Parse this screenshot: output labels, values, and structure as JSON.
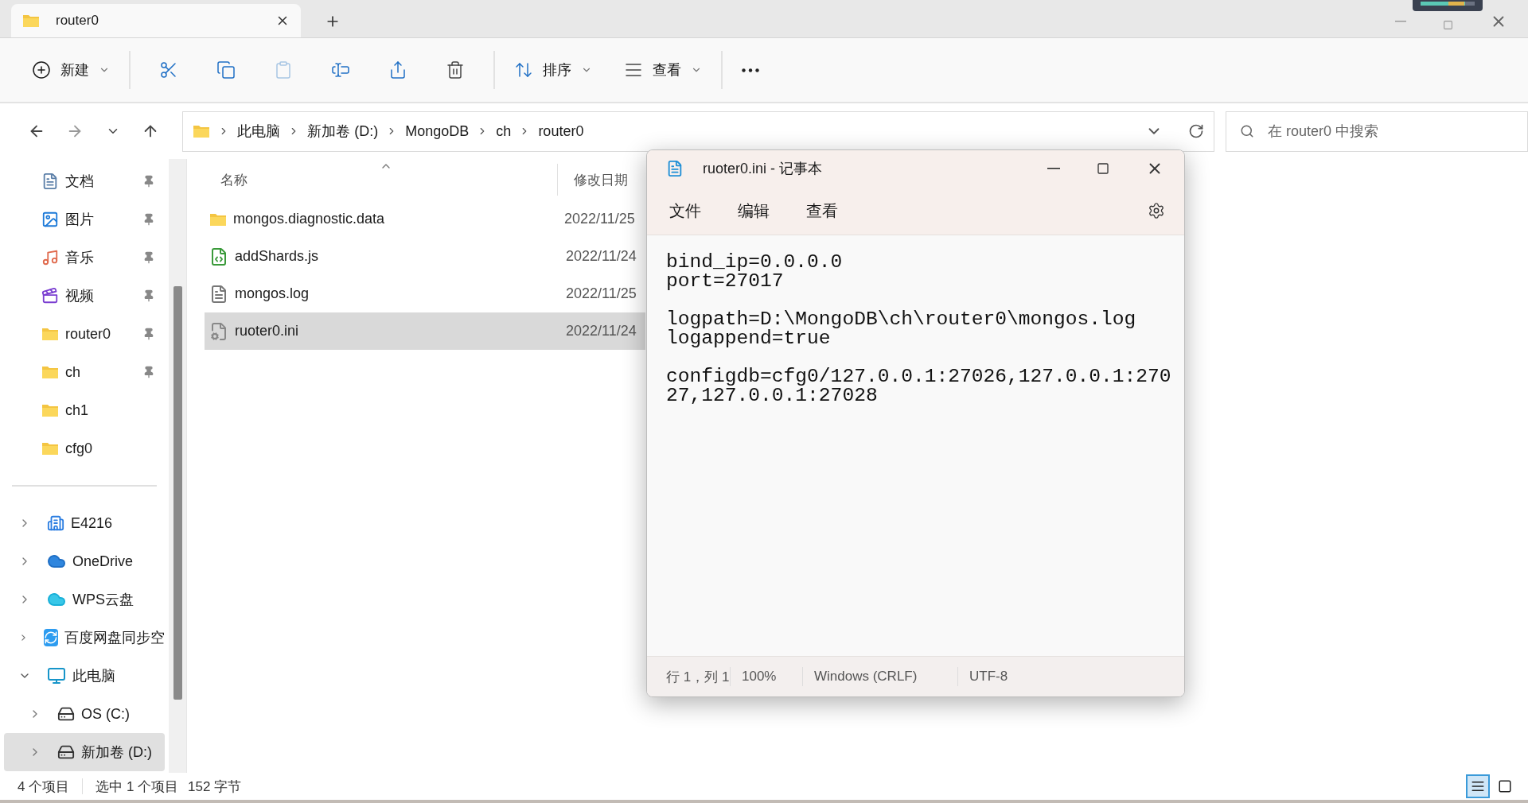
{
  "explorer": {
    "tab": {
      "title": "router0"
    },
    "toolbar": {
      "new": "新建",
      "sort": "排序",
      "view": "查看"
    },
    "breadcrumb": [
      "此电脑",
      "新加卷 (D:)",
      "MongoDB",
      "ch",
      "router0"
    ],
    "search": {
      "placeholder": "在 router0 中搜索"
    },
    "sidebar": {
      "quick_access": [
        {
          "label": "文档",
          "kind": "document",
          "pinned": true
        },
        {
          "label": "图片",
          "kind": "picture",
          "pinned": true
        },
        {
          "label": "音乐",
          "kind": "music",
          "pinned": true
        },
        {
          "label": "视频",
          "kind": "video",
          "pinned": true
        },
        {
          "label": "router0",
          "kind": "folder",
          "pinned": true
        },
        {
          "label": "ch",
          "kind": "folder",
          "pinned": true
        },
        {
          "label": "ch1",
          "kind": "folder",
          "pinned": false
        },
        {
          "label": "cfg0",
          "kind": "folder",
          "pinned": false
        }
      ],
      "tree": [
        {
          "label": "E4216",
          "kind": "building",
          "expanded": false,
          "selected": false
        },
        {
          "label": "OneDrive",
          "kind": "cloud",
          "expanded": false,
          "selected": false
        },
        {
          "label": "WPS云盘",
          "kind": "cloud",
          "expanded": false,
          "selected": false
        },
        {
          "label": "百度网盘同步空",
          "kind": "sync",
          "expanded": false,
          "selected": false
        },
        {
          "label": "此电脑",
          "kind": "pc",
          "expanded": true,
          "selected": false,
          "children": [
            {
              "label": "OS (C:)",
              "kind": "drive",
              "expanded": false,
              "selected": false
            },
            {
              "label": "新加卷 (D:)",
              "kind": "drive",
              "expanded": false,
              "selected": true
            }
          ]
        }
      ]
    },
    "columns": [
      {
        "label": "名称",
        "sorted": true
      },
      {
        "label": "修改日期",
        "sorted": false
      }
    ],
    "files": [
      {
        "name": "mongos.diagnostic.data",
        "date": "2022/11/25",
        "kind": "folder",
        "selected": false
      },
      {
        "name": "addShards.js",
        "date": "2022/11/24",
        "kind": "script",
        "selected": false
      },
      {
        "name": "mongos.log",
        "date": "2022/11/25",
        "kind": "text",
        "selected": false
      },
      {
        "name": "ruoter0.ini",
        "date": "2022/11/24",
        "kind": "settings",
        "selected": true
      }
    ],
    "status_bar": {
      "count": "4 个项目",
      "selection": "选中 1 个项目",
      "size": "152 字节"
    },
    "view_toggles": [
      {
        "kind": "details",
        "selected": true
      },
      {
        "kind": "tiles",
        "selected": false
      }
    ]
  },
  "notepad": {
    "title": "ruoter0.ini - 记事本",
    "menu": [
      "文件",
      "编辑",
      "查看"
    ],
    "paragraphs": [
      [
        "bind_ip=0.0.0.0",
        "port=27017"
      ],
      [
        "logpath=D:\\MongoDB\\ch\\router0\\mongos.log",
        "logappend=true"
      ],
      [
        "configdb=cfg0/127.0.0.1:27026,127.0.0.1:270",
        "27,127.0.0.1:27028"
      ]
    ],
    "status": [
      "行 1，列 1",
      "100%",
      "Windows (CRLF)",
      "UTF-8"
    ]
  }
}
